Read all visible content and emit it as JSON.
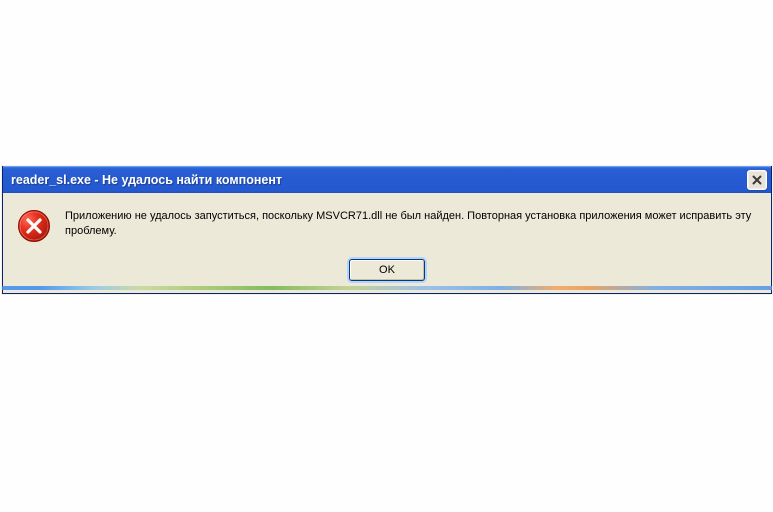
{
  "dialog": {
    "title": "reader_sl.exe - Не удалось найти компонент",
    "message": "Приложению не удалось запуститься, поскольку MSVCR71.dll не был найден. Повторная установка приложения может исправить эту проблему.",
    "ok_label": "OK"
  }
}
